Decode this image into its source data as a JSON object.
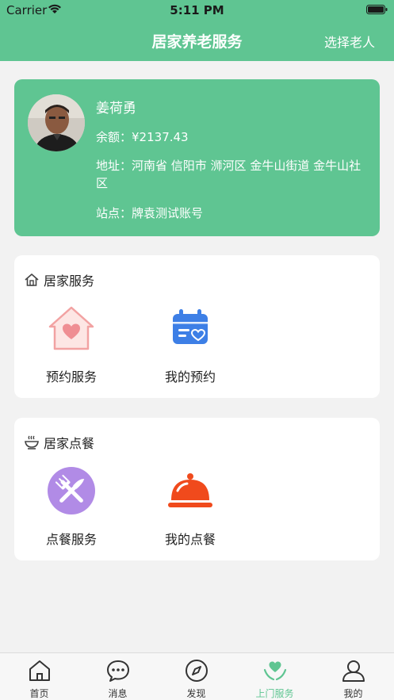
{
  "status_bar": {
    "carrier": "Carrier",
    "time": "5:11 PM"
  },
  "nav": {
    "title": "居家养老服务",
    "right_action": "选择老人"
  },
  "profile": {
    "name": "姜荷勇",
    "balance_label": "余额：",
    "balance_value": "¥2137.43",
    "address_label": "地址：",
    "address_value": "河南省 信阳市 浉河区 金牛山街道 金牛山社区",
    "station_label": "站点：",
    "station_value": "牌袁测试账号"
  },
  "home_service": {
    "title": "居家服务",
    "items": [
      {
        "label": "预约服务",
        "icon": "heart-house-icon"
      },
      {
        "label": "我的预约",
        "icon": "calendar-icon"
      }
    ]
  },
  "home_meal": {
    "title": "居家点餐",
    "items": [
      {
        "label": "点餐服务",
        "icon": "fork-knife-icon"
      },
      {
        "label": "我的点餐",
        "icon": "food-cloche-icon"
      }
    ]
  },
  "tabbar": {
    "items": [
      {
        "label": "首页",
        "icon": "home-icon"
      },
      {
        "label": "消息",
        "icon": "chat-icon"
      },
      {
        "label": "发现",
        "icon": "compass-icon"
      },
      {
        "label": "上门服务",
        "icon": "heart-hands-icon",
        "active": true
      },
      {
        "label": "我的",
        "icon": "user-icon"
      }
    ]
  },
  "colors": {
    "brand_green": "#5fc592",
    "calendar_blue": "#3d7fe6",
    "cloche_red": "#f04a1c",
    "fork_purple": "#b18be6",
    "house_pink": "#f5b2b2"
  }
}
